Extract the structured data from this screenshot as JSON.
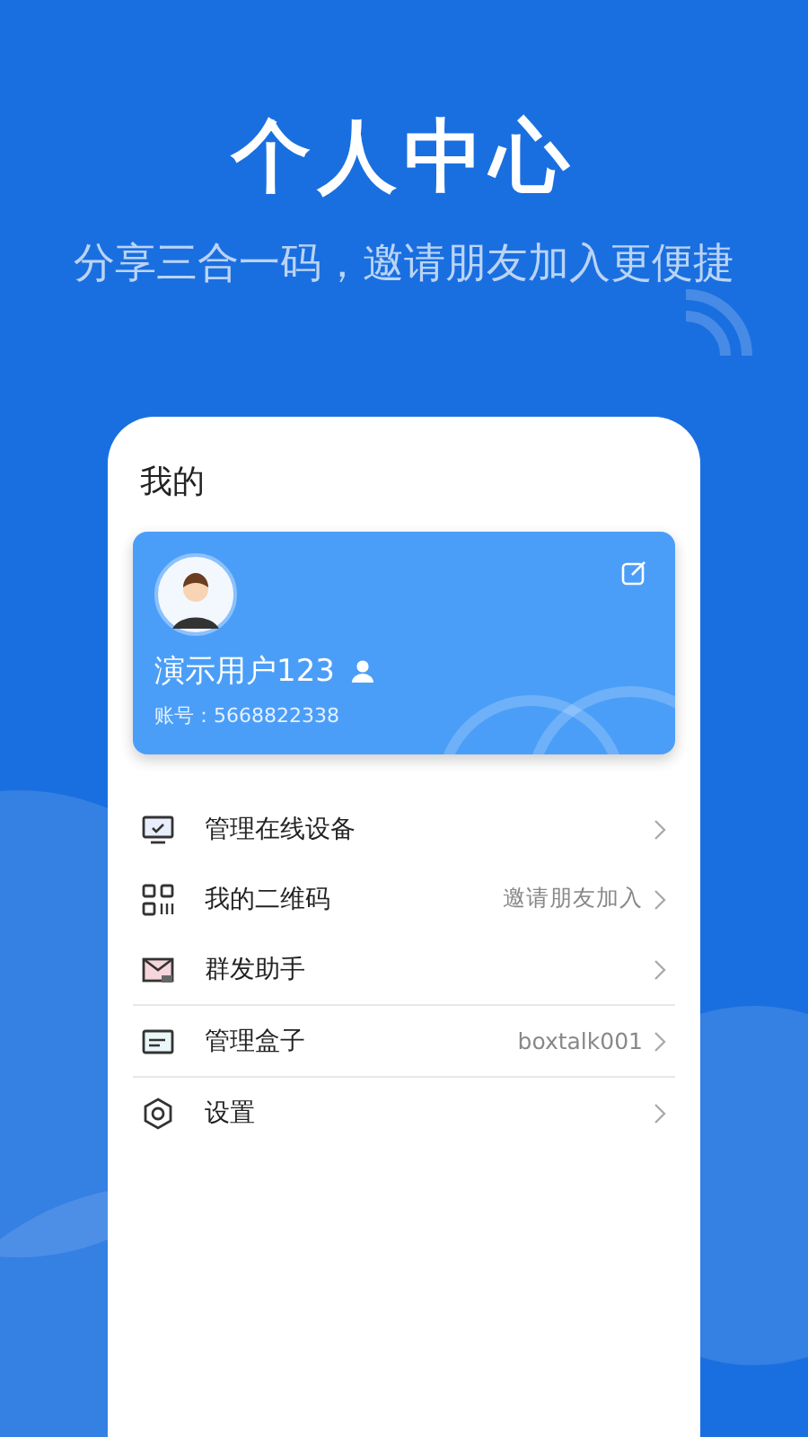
{
  "header": {
    "title": "个人中心",
    "subtitle": "分享三合一码，邀请朋友加入更便捷"
  },
  "panel": {
    "title": "我的"
  },
  "profile": {
    "name": "演示用户123",
    "account": "账号：5668822338"
  },
  "menu": [
    {
      "kind": "monitor",
      "label": "管理在线设备",
      "separated": false
    },
    {
      "kind": "qrcode",
      "label": "我的二维码",
      "value": "邀请朋友加入",
      "separated": false
    },
    {
      "kind": "mail",
      "label": "群发助手",
      "separated": false
    },
    {
      "kind": "box",
      "label": "管理盒子",
      "value": "boxtalk001",
      "separated": true
    },
    {
      "kind": "settings",
      "label": "设置",
      "separated": true
    }
  ]
}
